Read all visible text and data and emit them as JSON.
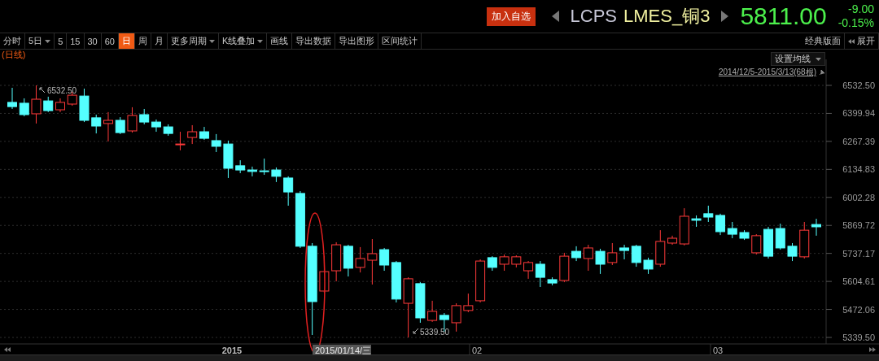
{
  "header": {
    "add_button": "加入自选",
    "code": "LCPS",
    "name": "LMES_铜3",
    "price": "5811.00",
    "change": "-9.00",
    "change_pct": "-0.15%"
  },
  "toolbar": {
    "items": [
      {
        "label": "分时",
        "kind": "tab",
        "selected": false
      },
      {
        "label": "5日",
        "kind": "dropdown",
        "selected": false
      },
      {
        "label": "5",
        "kind": "tab",
        "selected": false
      },
      {
        "label": "15",
        "kind": "tab",
        "selected": false
      },
      {
        "label": "30",
        "kind": "tab",
        "selected": false
      },
      {
        "label": "60",
        "kind": "tab",
        "selected": false
      },
      {
        "label": "日",
        "kind": "tab",
        "selected": true
      },
      {
        "label": "周",
        "kind": "tab",
        "selected": false
      },
      {
        "label": "月",
        "kind": "tab",
        "selected": false
      },
      {
        "label": "更多周期",
        "kind": "dropdown",
        "selected": false
      },
      {
        "label": "K线叠加",
        "kind": "dropdown",
        "selected": false
      },
      {
        "label": "画线",
        "kind": "tab",
        "selected": false
      },
      {
        "label": "导出数据",
        "kind": "tab",
        "selected": false
      },
      {
        "label": "导出图形",
        "kind": "tab",
        "selected": false
      },
      {
        "label": "区间统计",
        "kind": "tab",
        "selected": false
      }
    ],
    "layout_button": "经典版面",
    "expand_button": "展开"
  },
  "chart": {
    "period_label": "(日线)",
    "ma_button": "设置均线",
    "range": "2014/12/5-2015/3/13(68根)",
    "high_marker": "6532.50",
    "low_marker": "5339.50",
    "x_labels": [
      "2015",
      "02",
      "03"
    ],
    "crosshair_date": "2015/01/14/三",
    "chart_data": {
      "type": "candlestick",
      "grid": true,
      "ohlc": [
        [
          6452,
          6521,
          6421,
          6432
        ],
        [
          6448,
          6471,
          6386,
          6394
        ],
        [
          6398,
          6532.5,
          6352,
          6467
        ],
        [
          6459,
          6479,
          6406,
          6413
        ],
        [
          6417,
          6471,
          6406,
          6452
        ],
        [
          6444,
          6502,
          6436,
          6486
        ],
        [
          6482,
          6517,
          6359,
          6367
        ],
        [
          6379,
          6394,
          6305,
          6340
        ],
        [
          6352,
          6406,
          6267,
          6367
        ],
        [
          6367,
          6382,
          6302,
          6309
        ],
        [
          6317,
          6429,
          6309,
          6390
        ],
        [
          6394,
          6421,
          6348,
          6359
        ],
        [
          6359,
          6371,
          6313,
          6336
        ],
        [
          6336,
          6348,
          6294,
          6305
        ],
        [
          6252,
          6313,
          6225,
          6255
        ],
        [
          6286,
          6344,
          6255,
          6313
        ],
        [
          6313,
          6336,
          6275,
          6282
        ],
        [
          6271,
          6302,
          6217,
          6244
        ],
        [
          6255,
          6271,
          6094,
          6140
        ],
        [
          6152,
          6178,
          6117,
          6132
        ],
        [
          6132,
          6148,
          6102,
          6125
        ],
        [
          6128,
          6186,
          6109,
          6125
        ],
        [
          6132,
          6144,
          6075,
          6102
        ],
        [
          6094,
          6102,
          5963,
          6028
        ],
        [
          6021,
          6032,
          5763,
          5771
        ],
        [
          5771,
          5786,
          5351,
          5509
        ],
        [
          5559,
          5724,
          5551,
          5651
        ],
        [
          5655,
          5790,
          5605,
          5778
        ],
        [
          5771,
          5778,
          5628,
          5667
        ],
        [
          5671,
          5767,
          5647,
          5713
        ],
        [
          5705,
          5805,
          5590,
          5736
        ],
        [
          5755,
          5763,
          5655,
          5682
        ],
        [
          5694,
          5701,
          5505,
          5521
        ],
        [
          5501,
          5624,
          5339.5,
          5617
        ],
        [
          5594,
          5601,
          5409,
          5432
        ],
        [
          5420,
          5513,
          5413,
          5463
        ],
        [
          5444,
          5455,
          5367,
          5424
        ],
        [
          5409,
          5501,
          5367,
          5490
        ],
        [
          5467,
          5547,
          5459,
          5490
        ],
        [
          5513,
          5709,
          5505,
          5701
        ],
        [
          5717,
          5724,
          5655,
          5671
        ],
        [
          5686,
          5732,
          5655,
          5721
        ],
        [
          5686,
          5728,
          5671,
          5721
        ],
        [
          5655,
          5701,
          5617,
          5694
        ],
        [
          5686,
          5701,
          5578,
          5624
        ],
        [
          5613,
          5624,
          5586,
          5597
        ],
        [
          5609,
          5740,
          5601,
          5724
        ],
        [
          5747,
          5771,
          5701,
          5717
        ],
        [
          5713,
          5778,
          5655,
          5763
        ],
        [
          5747,
          5759,
          5640,
          5686
        ],
        [
          5694,
          5786,
          5682,
          5740
        ],
        [
          5763,
          5778,
          5709,
          5751
        ],
        [
          5771,
          5778,
          5674,
          5694
        ],
        [
          5705,
          5717,
          5640,
          5663
        ],
        [
          5686,
          5847,
          5674,
          5794
        ],
        [
          5786,
          5821,
          5778,
          5809
        ],
        [
          5782,
          5951,
          5775,
          5913
        ],
        [
          5901,
          5917,
          5863,
          5894
        ],
        [
          5925,
          5963,
          5886,
          5909
        ],
        [
          5917,
          5925,
          5824,
          5840
        ],
        [
          5855,
          5886,
          5809,
          5828
        ],
        [
          5836,
          5847,
          5801,
          5809
        ],
        [
          5740,
          5828,
          5732,
          5821
        ],
        [
          5851,
          5863,
          5713,
          5724
        ],
        [
          5855,
          5878,
          5755,
          5763
        ],
        [
          5771,
          5786,
          5701,
          5724
        ],
        [
          5721,
          5886,
          5713,
          5847
        ],
        [
          5874,
          5901,
          5821,
          5863
        ]
      ],
      "ylim": [
        5339.5,
        6532.5
      ],
      "yticks": [
        {
          "value": 6532.5,
          "label": "6532.50"
        },
        {
          "value": 6399.94,
          "label": "6399.94"
        },
        {
          "value": 6267.39,
          "label": "6267.39"
        },
        {
          "value": 6134.83,
          "label": "6134.83"
        },
        {
          "value": 6002.28,
          "label": "6002.28"
        },
        {
          "value": 5869.72,
          "label": "5869.72"
        },
        {
          "value": 5737.17,
          "label": "5737.17"
        },
        {
          "value": 5604.61,
          "label": "5604.61"
        },
        {
          "value": 5472.06,
          "label": "5472.06"
        },
        {
          "value": 5339.5,
          "label": "5339.50"
        }
      ]
    }
  }
}
